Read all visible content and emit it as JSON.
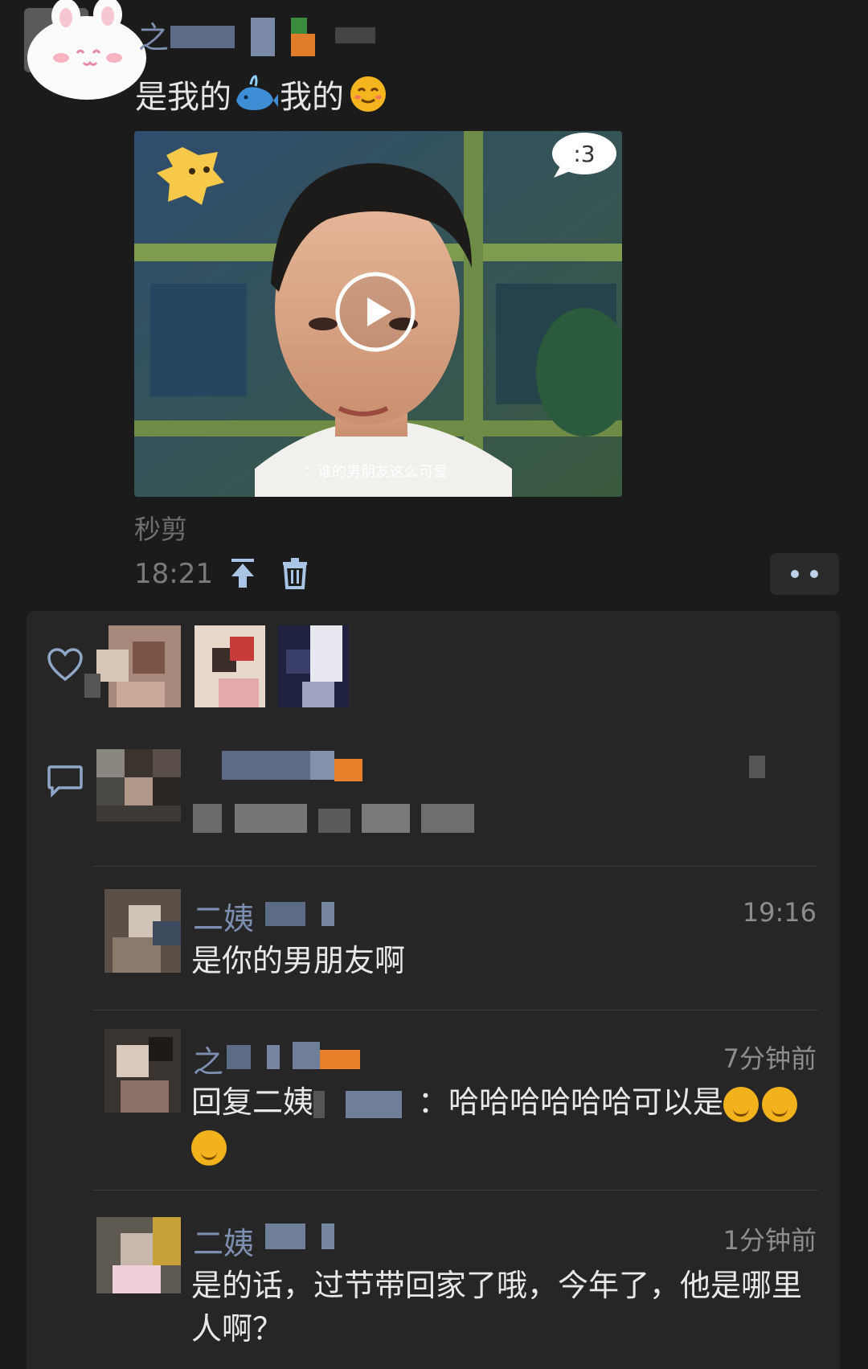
{
  "post": {
    "author_name_visible": "之",
    "text_part1": "是我的",
    "text_part2": "我的",
    "icon_after_part1": "whale-emoji-icon",
    "icon_after_part2": "smiling-face-emoji-icon",
    "video": {
      "bubble_text": ":3",
      "subtitle": "：谁的男朋友这么可爱"
    },
    "source_label": "秒剪",
    "time": "18:21"
  },
  "likes": {
    "icon": "heart-outline-icon"
  },
  "comments_icon": "speech-bubble-icon",
  "comments": [
    {
      "name": "二姨",
      "time": "19:16",
      "text": "是你的男朋友啊"
    },
    {
      "name": "之",
      "time": "7分钟前",
      "text_prefix": "回复二姨",
      "text_suffix": "：哈哈哈哈哈哈可以是"
    },
    {
      "name": "二姨",
      "time": "1分钟前",
      "text": "是的话，过节带回家了哦，今年了，他是哪里人啊？"
    }
  ],
  "colors": {
    "background": "#1b1b1b",
    "panel": "#262626",
    "name_link": "#7d8fb0",
    "text": "#e8e8e8",
    "secondary": "#8d8d8d"
  }
}
